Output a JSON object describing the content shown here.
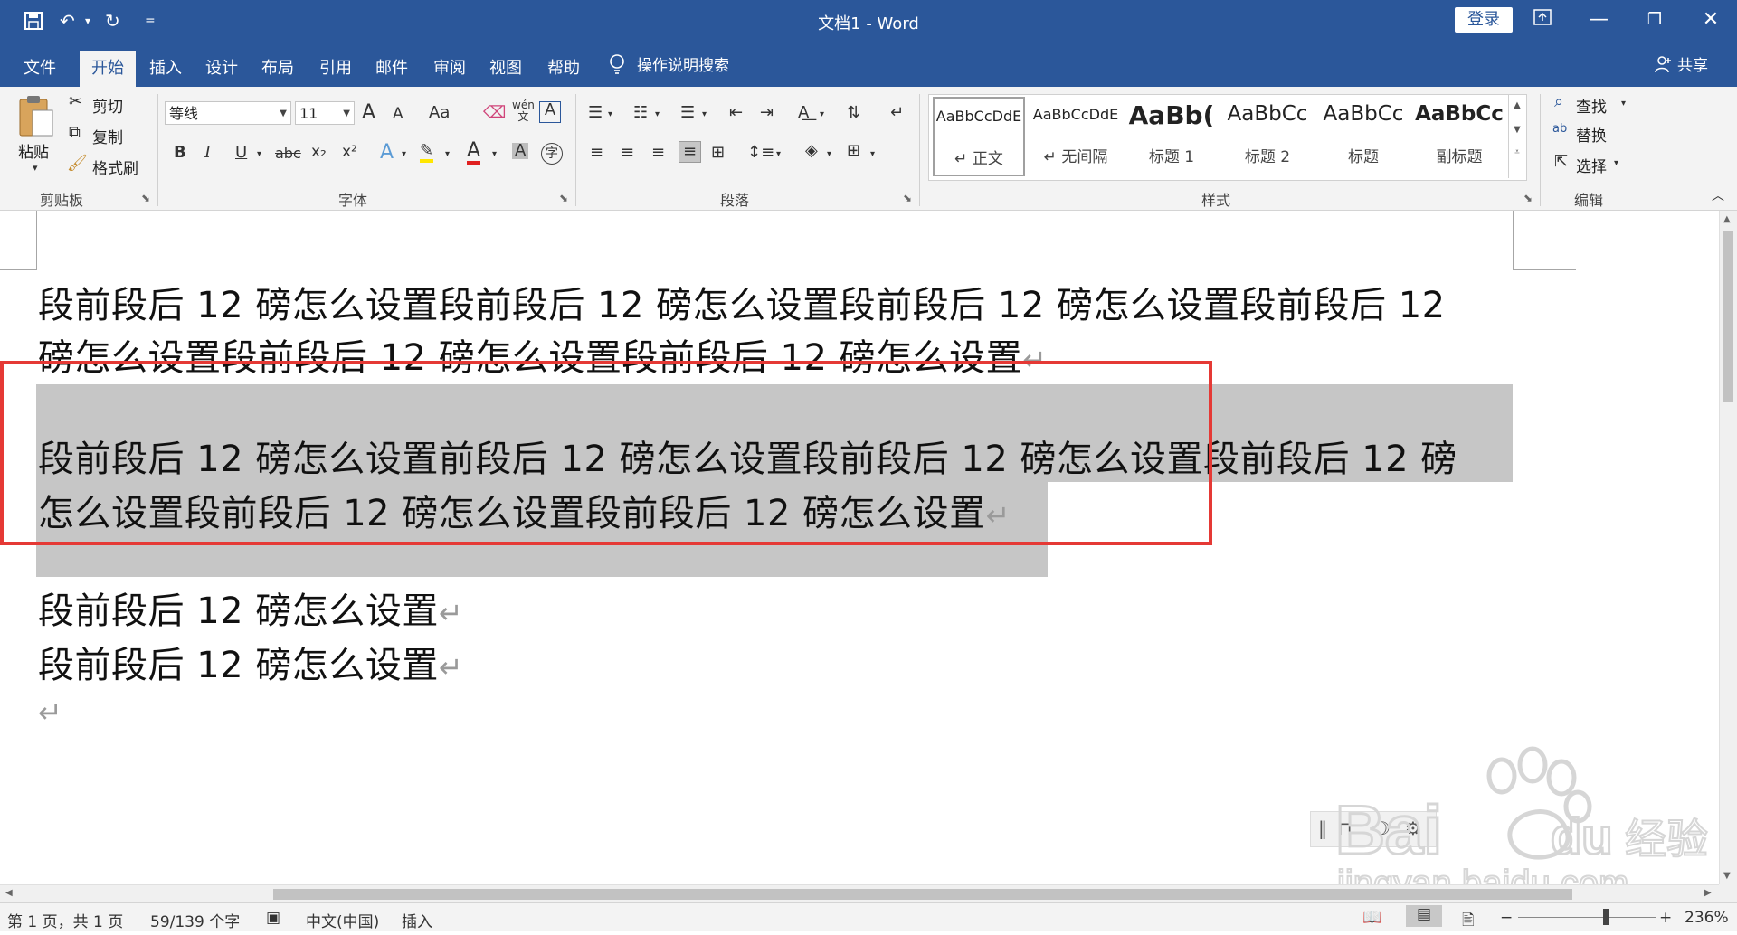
{
  "titlebar": {
    "title": "文档1  -  Word",
    "login": "登录",
    "qat_customize": "="
  },
  "tabs": {
    "file": "文件",
    "home": "开始",
    "insert": "插入",
    "design": "设计",
    "layout": "布局",
    "references": "引用",
    "mailings": "邮件",
    "review": "审阅",
    "view": "视图",
    "help": "帮助",
    "tell_me": "操作说明搜索",
    "share": "共享"
  },
  "clipboard": {
    "paste": "粘贴",
    "cut": "剪切",
    "copy": "复制",
    "format_painter": "格式刷",
    "group": "剪贴板"
  },
  "font": {
    "name": "等线",
    "size": "11",
    "group": "字体",
    "bold": "B",
    "italic": "I",
    "underline": "U",
    "strike": "abc",
    "subscript": "x₂",
    "superscript": "x²",
    "grow": "A",
    "shrink": "A",
    "change_case": "Aa",
    "phonetic": "wén\n文",
    "char_border": "A",
    "font_color": "A",
    "char_shading": "A",
    "enclose": "字"
  },
  "paragraph": {
    "group": "段落"
  },
  "styles": {
    "group": "样式",
    "items": [
      {
        "sample": "AaBbCcDdE",
        "name": "↵ 正文"
      },
      {
        "sample": "AaBbCcDdE",
        "name": "↵ 无间隔"
      },
      {
        "sample": "AaBb(",
        "name": "标题 1"
      },
      {
        "sample": "AaBbCc",
        "name": "标题 2"
      },
      {
        "sample": "AaBbCc",
        "name": "标题"
      },
      {
        "sample": "AaBbCc",
        "name": "副标题"
      }
    ]
  },
  "editing": {
    "find": "查找",
    "replace": "替换",
    "select": "选择",
    "group": "编辑"
  },
  "document": {
    "p1_l1": "段前段后 12 磅怎么设置段前段后 12 磅怎么设置段前段后 12 磅怎么设置段前段后 12",
    "p1_l2": "磅怎么设置段前段后 12 磅怎么设置段前段后 12 磅怎么设置",
    "p2_l1": "段前段后 12 磅怎么设置前段后 12 磅怎么设置段前段后 12 磅怎么设置段前段后 12 磅",
    "p2_l2": "怎么设置段前段后 12 磅怎么设置段前段后 12 磅怎么设置",
    "p3": "段前段后 12 磅怎么设置",
    "p4": "段前段后 12 磅怎么设置",
    "para_mark": "↵"
  },
  "statusbar": {
    "page": "第 1 页，共 1 页",
    "words": "59/139 个字",
    "language": "中文(中国)",
    "mode": "插入",
    "zoom": "236%",
    "minus": "−",
    "plus": "+"
  },
  "watermark": {
    "brand": "Bai du 经验",
    "url": "jingyan.baidu.com"
  },
  "colors": {
    "accent": "#2b579a",
    "selection": "#c6c6c6",
    "annotation_box": "#e53935"
  }
}
